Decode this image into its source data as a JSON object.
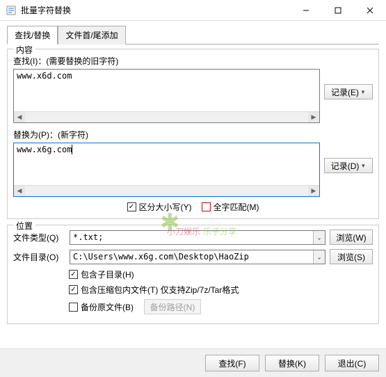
{
  "window": {
    "title": "批量字符替换"
  },
  "tabs": {
    "t0": "查找/替换",
    "t1": "文件首/尾添加"
  },
  "group_content": {
    "title": "内容",
    "find_label": "查找(I)：(需要替换的旧字符)",
    "find_value": "www.x6d.com",
    "record_e": "记录(E)",
    "replace_label": "替换为(P)：(新字符)",
    "replace_value": "www.x6g.com",
    "record_d": "记录(D)",
    "case_label": "区分大小写(Y)",
    "whole_label": "全字匹配(M)"
  },
  "group_location": {
    "title": "位置",
    "filetype_label": "文件类型(Q)",
    "filetype_value": "*.txt;",
    "browse_w": "浏览(W)",
    "filedir_label": "文件目录(O)",
    "filedir_value": "C:\\Users\\www.x6g.com\\Desktop\\HaoZip",
    "browse_s": "浏览(S)",
    "include_sub": "包含子目录(H)",
    "include_zip": "包含压缩包内文件(T) 仅支持Zip/7z/Tar格式",
    "backup": "备份原文件(B)",
    "backup_path": "备份路径(N)"
  },
  "buttons": {
    "find": "查找(F)",
    "replace": "替换(K)",
    "exit": "退出(C)"
  },
  "watermark": {
    "line1": "小刀娱乐",
    "line2": "乐子分享"
  }
}
